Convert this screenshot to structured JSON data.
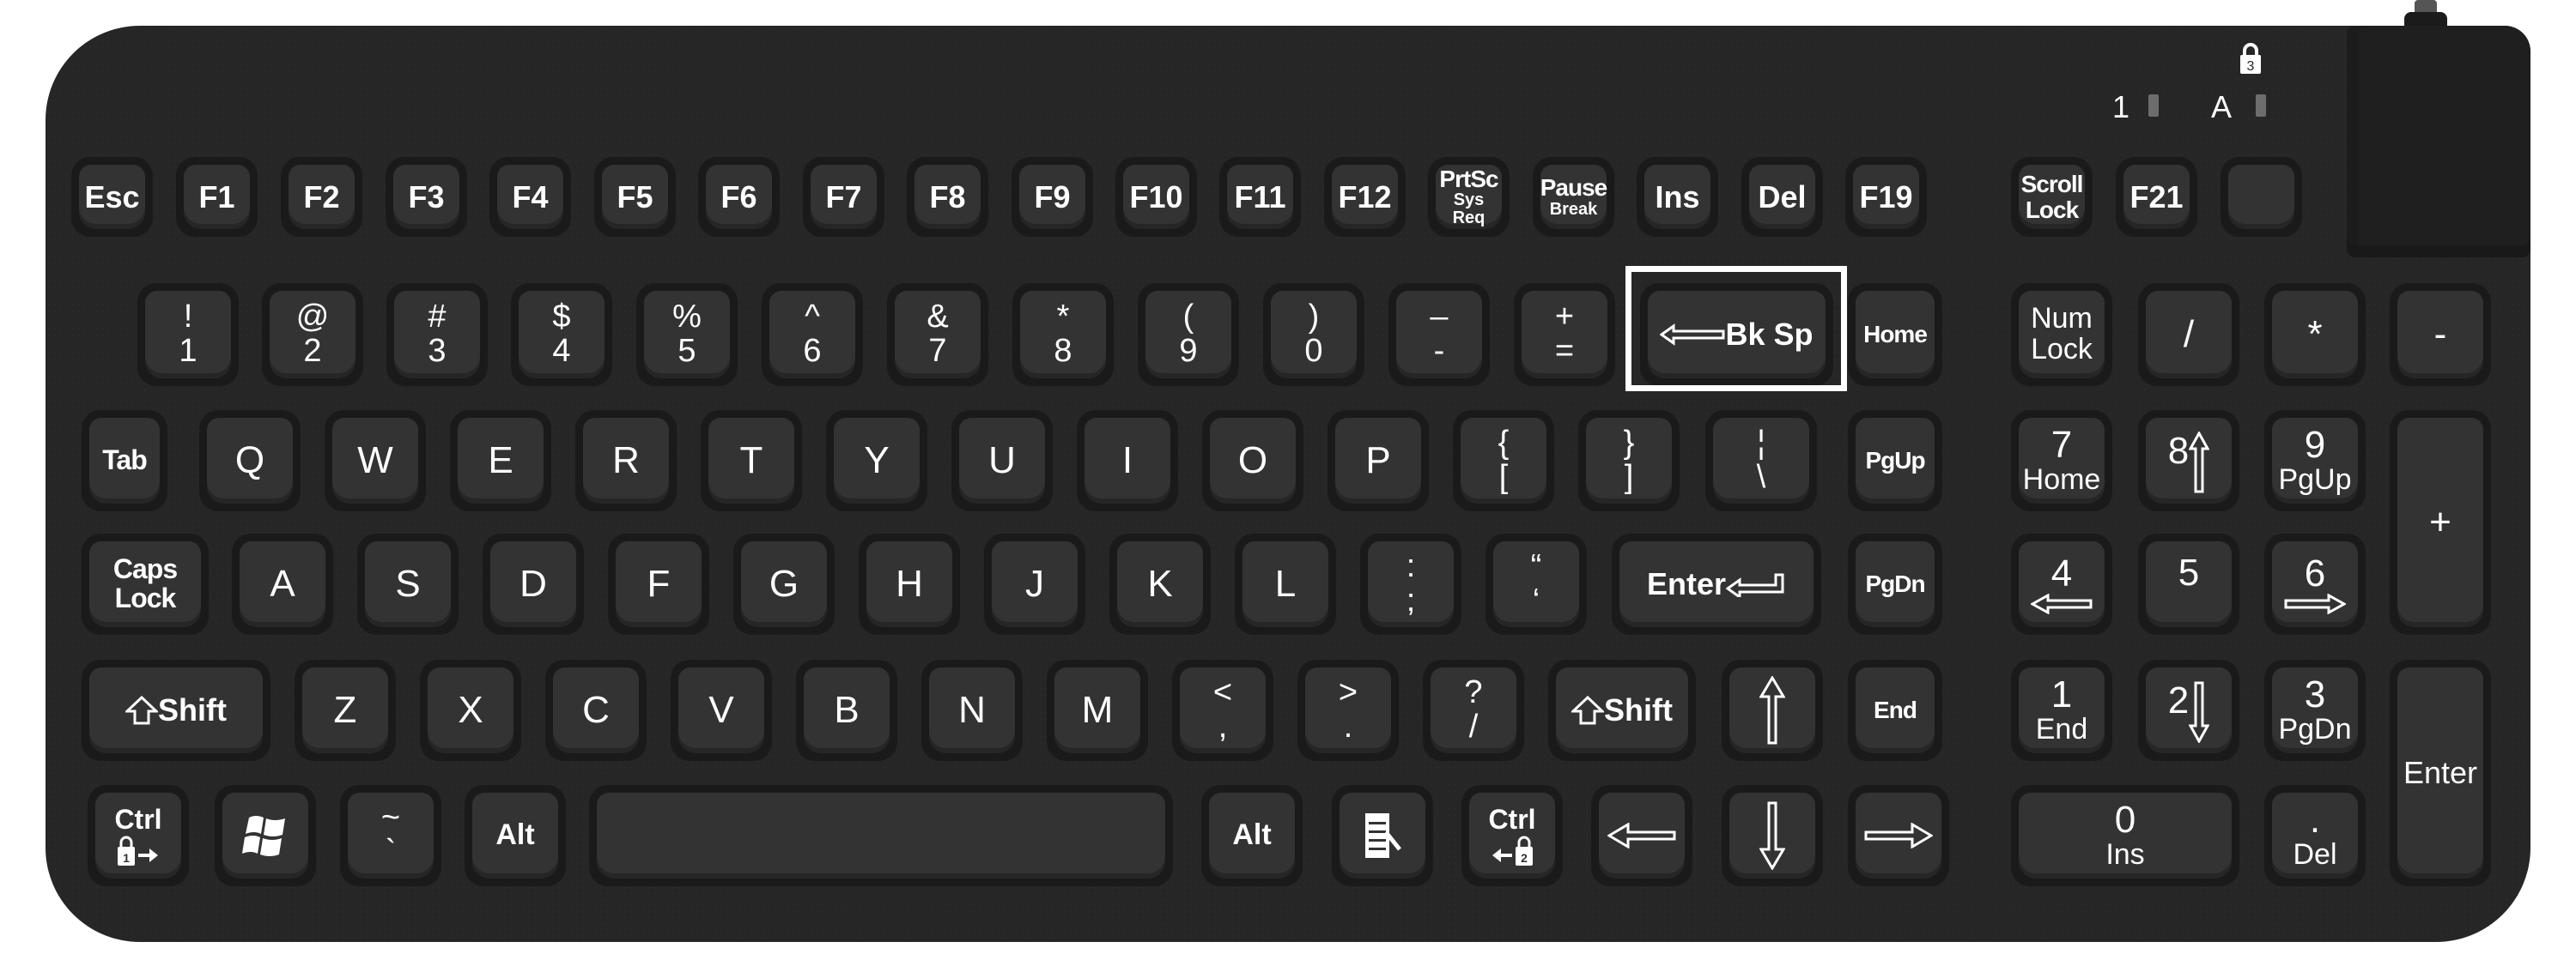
{
  "keyboard": {
    "indicators": {
      "num_label": "1",
      "caps_label": "A",
      "scroll_lock_number": "3"
    },
    "function_row": [
      {
        "id": "esc",
        "label": "Esc"
      },
      {
        "id": "f1",
        "label": "F1"
      },
      {
        "id": "f2",
        "label": "F2"
      },
      {
        "id": "f3",
        "label": "F3"
      },
      {
        "id": "f4",
        "label": "F4"
      },
      {
        "id": "f5",
        "label": "F5"
      },
      {
        "id": "f6",
        "label": "F6"
      },
      {
        "id": "f7",
        "label": "F7"
      },
      {
        "id": "f8",
        "label": "F8"
      },
      {
        "id": "f9",
        "label": "F9"
      },
      {
        "id": "f10",
        "label": "F10"
      },
      {
        "id": "f11",
        "label": "F11"
      },
      {
        "id": "f12",
        "label": "F12"
      },
      {
        "id": "prtsc",
        "label": "PrtSc",
        "sub": "Sys Req"
      },
      {
        "id": "pause",
        "label": "Pause",
        "sub": "Break"
      },
      {
        "id": "ins",
        "label": "Ins"
      },
      {
        "id": "del",
        "label": "Del"
      },
      {
        "id": "f19",
        "label": "F19"
      },
      {
        "id": "scroll-lock",
        "label": "Scroll",
        "sub": "Lock"
      },
      {
        "id": "f21",
        "label": "F21"
      },
      {
        "id": "blank",
        "label": ""
      }
    ],
    "number_row": [
      {
        "top": "!",
        "bottom": "1"
      },
      {
        "top": "@",
        "bottom": "2"
      },
      {
        "top": "#",
        "bottom": "3"
      },
      {
        "top": "$",
        "bottom": "4"
      },
      {
        "top": "%",
        "bottom": "5"
      },
      {
        "top": "^",
        "bottom": "6"
      },
      {
        "top": "&",
        "bottom": "7"
      },
      {
        "top": "*",
        "bottom": "8"
      },
      {
        "top": "(",
        "bottom": "9"
      },
      {
        "top": ")",
        "bottom": "0"
      },
      {
        "top": "–",
        "bottom": "-"
      },
      {
        "top": "+",
        "bottom": "="
      }
    ],
    "backspace": "Bk Sp",
    "home": "Home",
    "pgup": "PgUp",
    "pgdn": "PgDn",
    "end": "End",
    "tab": "Tab",
    "qwerty_row": [
      "Q",
      "W",
      "E",
      "R",
      "T",
      "Y",
      "U",
      "I",
      "O",
      "P"
    ],
    "qwerty_symbols": [
      {
        "top": "{",
        "bottom": "["
      },
      {
        "top": "}",
        "bottom": "]"
      },
      {
        "top": "¦",
        "bottom": "\\"
      }
    ],
    "caps_lock": {
      "line1": "Caps",
      "line2": "Lock"
    },
    "home_row": [
      "A",
      "S",
      "D",
      "F",
      "G",
      "H",
      "J",
      "K",
      "L"
    ],
    "home_symbols": [
      {
        "top": ":",
        "bottom": ";"
      },
      {
        "top": "“",
        "bottom": "‘"
      }
    ],
    "enter": "Enter",
    "shift": "Shift",
    "bottom_letters": [
      "Z",
      "X",
      "C",
      "V",
      "B",
      "N",
      "M"
    ],
    "bottom_symbols": [
      {
        "top": "<",
        "bottom": ","
      },
      {
        "top": ">",
        "bottom": "."
      },
      {
        "top": "?",
        "bottom": "/"
      }
    ],
    "ctrl": "Ctrl",
    "ctrl_left_lock": "1",
    "ctrl_right_lock": "2",
    "tilde": {
      "top": "~",
      "bottom": "`"
    },
    "alt": "Alt",
    "numpad": {
      "numlock": {
        "line1": "Num",
        "line2": "Lock"
      },
      "divide": "/",
      "multiply": "*",
      "minus": "-",
      "plus": "+",
      "n7": {
        "top": "7",
        "bottom": "Home"
      },
      "n8": {
        "top": "8"
      },
      "n9": {
        "top": "9",
        "bottom": "PgUp"
      },
      "n4": {
        "top": "4"
      },
      "n5": {
        "top": "5"
      },
      "n6": {
        "top": "6"
      },
      "n1": {
        "top": "1",
        "bottom": "End"
      },
      "n2": {
        "top": "2"
      },
      "n3": {
        "top": "3",
        "bottom": "PgDn"
      },
      "n0": {
        "top": "0",
        "bottom": "Ins"
      },
      "dot": {
        "top": ".",
        "bottom": "Del"
      },
      "enter": "Enter"
    },
    "highlighted_key": "Bk Sp"
  }
}
